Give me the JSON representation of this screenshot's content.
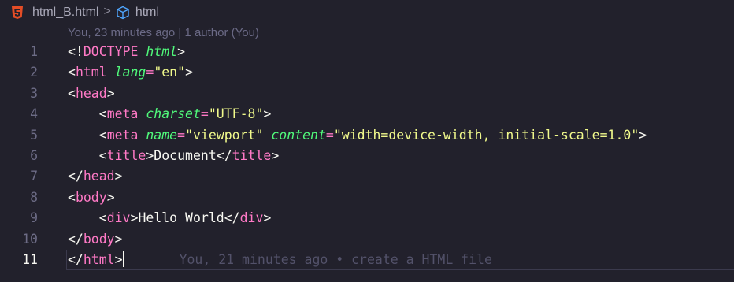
{
  "breadcrumb": {
    "file": "html_B.html",
    "separator": ">",
    "symbol": "html"
  },
  "codelens": "You, 23 minutes ago | 1 author (You)",
  "lines": [
    {
      "n": "1",
      "indent": "",
      "tokens": [
        [
          "p",
          "<!"
        ],
        [
          "t",
          "DOCTYPE"
        ],
        [
          "p",
          " "
        ],
        [
          "a",
          "html"
        ],
        [
          "p",
          ">"
        ]
      ]
    },
    {
      "n": "2",
      "indent": "",
      "tokens": [
        [
          "p",
          "<"
        ],
        [
          "t",
          "html"
        ],
        [
          "p",
          " "
        ],
        [
          "a",
          "lang"
        ],
        [
          "t",
          "="
        ],
        [
          "s",
          "\"en\""
        ],
        [
          "p",
          ">"
        ]
      ]
    },
    {
      "n": "3",
      "indent": "",
      "tokens": [
        [
          "p",
          "<"
        ],
        [
          "t",
          "head"
        ],
        [
          "p",
          ">"
        ]
      ]
    },
    {
      "n": "4",
      "indent": "    ",
      "tokens": [
        [
          "p",
          "<"
        ],
        [
          "t",
          "meta"
        ],
        [
          "p",
          " "
        ],
        [
          "a",
          "charset"
        ],
        [
          "t",
          "="
        ],
        [
          "s",
          "\"UTF-8\""
        ],
        [
          "p",
          ">"
        ]
      ]
    },
    {
      "n": "5",
      "indent": "    ",
      "tokens": [
        [
          "p",
          "<"
        ],
        [
          "t",
          "meta"
        ],
        [
          "p",
          " "
        ],
        [
          "a",
          "name"
        ],
        [
          "t",
          "="
        ],
        [
          "s",
          "\"viewport\""
        ],
        [
          "p",
          " "
        ],
        [
          "a",
          "content"
        ],
        [
          "t",
          "="
        ],
        [
          "s",
          "\"width=device-width, initial-scale=1.0\""
        ],
        [
          "p",
          ">"
        ]
      ]
    },
    {
      "n": "6",
      "indent": "    ",
      "tokens": [
        [
          "p",
          "<"
        ],
        [
          "t",
          "title"
        ],
        [
          "p",
          ">"
        ],
        [
          "txt",
          "Document"
        ],
        [
          "p",
          "</"
        ],
        [
          "t",
          "title"
        ],
        [
          "p",
          ">"
        ]
      ]
    },
    {
      "n": "7",
      "indent": "",
      "tokens": [
        [
          "p",
          "</"
        ],
        [
          "t",
          "head"
        ],
        [
          "p",
          ">"
        ]
      ]
    },
    {
      "n": "8",
      "indent": "",
      "tokens": [
        [
          "p",
          "<"
        ],
        [
          "t",
          "body"
        ],
        [
          "p",
          ">"
        ]
      ]
    },
    {
      "n": "9",
      "indent": "    ",
      "tokens": [
        [
          "p",
          "<"
        ],
        [
          "t",
          "div"
        ],
        [
          "p",
          ">"
        ],
        [
          "txt",
          "Hello World"
        ],
        [
          "p",
          "</"
        ],
        [
          "t",
          "div"
        ],
        [
          "p",
          ">"
        ]
      ]
    },
    {
      "n": "10",
      "indent": "",
      "tokens": [
        [
          "p",
          "</"
        ],
        [
          "t",
          "body"
        ],
        [
          "p",
          ">"
        ]
      ]
    },
    {
      "n": "11",
      "indent": "",
      "tokens": [
        [
          "p",
          "</"
        ],
        [
          "t",
          "html"
        ],
        [
          "p",
          ">"
        ]
      ],
      "current": true
    }
  ],
  "inline_blame": "You, 21 minutes ago • create a HTML file",
  "colors": {
    "background": "#22212c",
    "tag": "#ff79c6",
    "attribute": "#50fa7b",
    "string": "#f1fa8c",
    "punctuation": "#f8f8f2",
    "html5_icon": "#e44d26",
    "symbol_icon": "#4fa7ff"
  },
  "icons": {
    "file_icon": "html5-icon",
    "symbol_icon": "cube-icon",
    "separator_icon": "chevron-right-icon"
  }
}
